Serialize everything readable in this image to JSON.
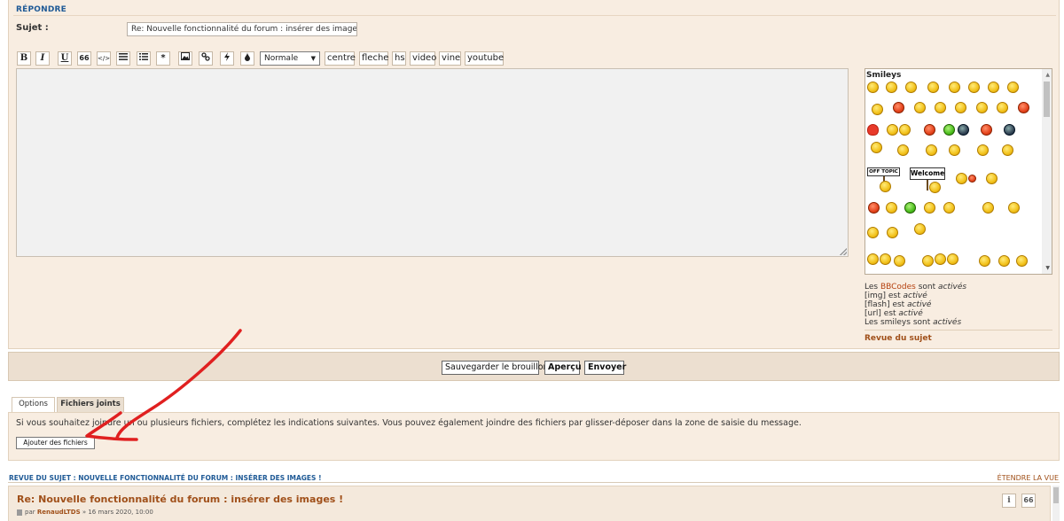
{
  "reply": {
    "heading": "RÉPONDRE",
    "subject_label": "Sujet :",
    "subject_value": "Re: Nouvelle fonctionnalité du forum : insérer des images !"
  },
  "toolbar": {
    "buttons": [
      "B",
      "I",
      "U",
      "66",
      "</>",
      "list-icon",
      "ordered-list-icon",
      "*",
      "image-icon",
      "link-icon",
      "flash-icon",
      "drop-icon"
    ],
    "font_size_value": "Normale",
    "text_buttons": [
      "centre",
      "fleche",
      "hs",
      "video",
      "vine",
      "youtube"
    ]
  },
  "smileys": {
    "title": "Smileys",
    "sign_offtopic": "OFF TOPIC",
    "sign_welcome": "Welcome"
  },
  "bbcode_info": {
    "line1_prefix": "Les ",
    "line1_link": "BBCodes",
    "line1_suffix": " sont ",
    "line1_state": "activés",
    "line2_prefix": "[img] est ",
    "line2_state": "activé",
    "line3_prefix": "[flash] est ",
    "line3_state": "activé",
    "line4_prefix": "[url] est ",
    "line4_state": "activé",
    "line5_prefix": "Les smileys sont ",
    "line5_state": "activés",
    "revue_link": "Revue du sujet"
  },
  "actions": {
    "save_draft": "Sauvegarder le brouillon",
    "preview": "Aperçu",
    "send": "Envoyer"
  },
  "tabs": {
    "options": "Options",
    "attachments": "Fichiers joints"
  },
  "attachments": {
    "description": "Si vous souhaitez joindre un ou plusieurs fichiers, complétez les indications suivantes. Vous pouvez également joindre des fichiers par glisser-déposer dans la zone de saisie du message.",
    "add_button": "Ajouter des fichiers"
  },
  "review": {
    "header": "REVUE DU SUJET : NOUVELLE FONCTIONNALITÉ DU FORUM : INSÉRER DES IMAGES !",
    "expand": "ÉTENDRE LA VUE",
    "post_title": "Re: Nouvelle fonctionnalité du forum : insérer des images !",
    "post_by": "par ",
    "post_author": "RenaudLTDS",
    "post_date": " » 16 mars 2020, 10:00",
    "info_button": "i",
    "quote_button": "66"
  },
  "colors": {
    "panel_bg": "#f8ede1",
    "link_blue": "#1f5a96",
    "accent_orange": "#a0501a",
    "annotation_red": "#e02020"
  }
}
